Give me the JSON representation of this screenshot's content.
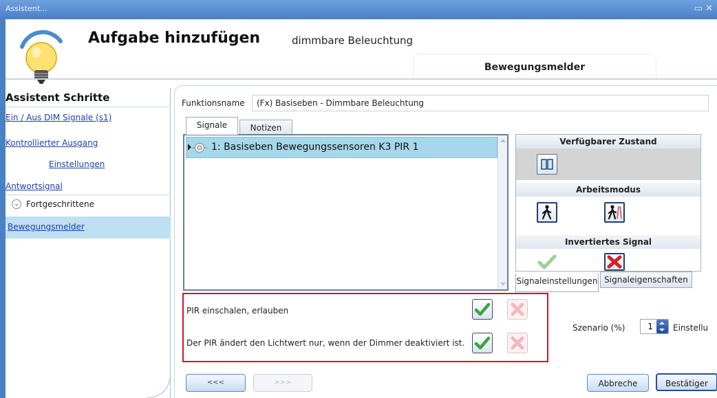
{
  "window": {
    "title": "Assistent...",
    "controls": "▭ ✕"
  },
  "header": {
    "title": "Aufgabe hinzufügen",
    "subtitle": "dimmbare Beleuchtung",
    "tab": "Bewegungsmelder"
  },
  "sidebar": {
    "heading": "Assistent Schritte",
    "items": [
      {
        "label": "Ein / Aus DIM Signale (s1)"
      },
      {
        "label": "Kontrollierter Ausgang"
      },
      {
        "label": "Einstellungen"
      },
      {
        "label": "Antwortsignal"
      }
    ],
    "advanced": "Fortgeschrittene",
    "selected": "Bewegungsmelder"
  },
  "main": {
    "function_label": "Funktionsname",
    "function_value": "(Fx) Basiseben - Dimmbare Beleuchtung",
    "tabs": [
      {
        "label": "Signale"
      },
      {
        "label": "Notizen"
      }
    ],
    "signal_row": "1: Basiseben Bewegungssensoren K3 PIR 1",
    "props": {
      "available_state": "Verfügbarer Zustand",
      "work_mode": "Arbeitsmodus",
      "inverted_signal": "Invertiertes Signal"
    },
    "subtabs": [
      {
        "label": "Signaleinstellungen"
      },
      {
        "label": "Signaleigenschaften"
      }
    ],
    "options": [
      {
        "label": "PIR einschalen, erlauben"
      },
      {
        "label": "Der PIR ändert den Lichtwert nur, wenn der Dimmer deaktiviert ist."
      }
    ],
    "scenario": {
      "label": "Szenario (%)",
      "value": "1",
      "next_label": "Einstellu"
    }
  },
  "buttons": {
    "back": "<<<",
    "next": ">>>",
    "cancel": "Abbreche",
    "ok": "Bestätiger"
  },
  "colors": {
    "titlebar": "#4b80c8",
    "selection": "#bfe0f2",
    "highlight_border": "#d1132a",
    "check_green": "#3aa63a"
  }
}
